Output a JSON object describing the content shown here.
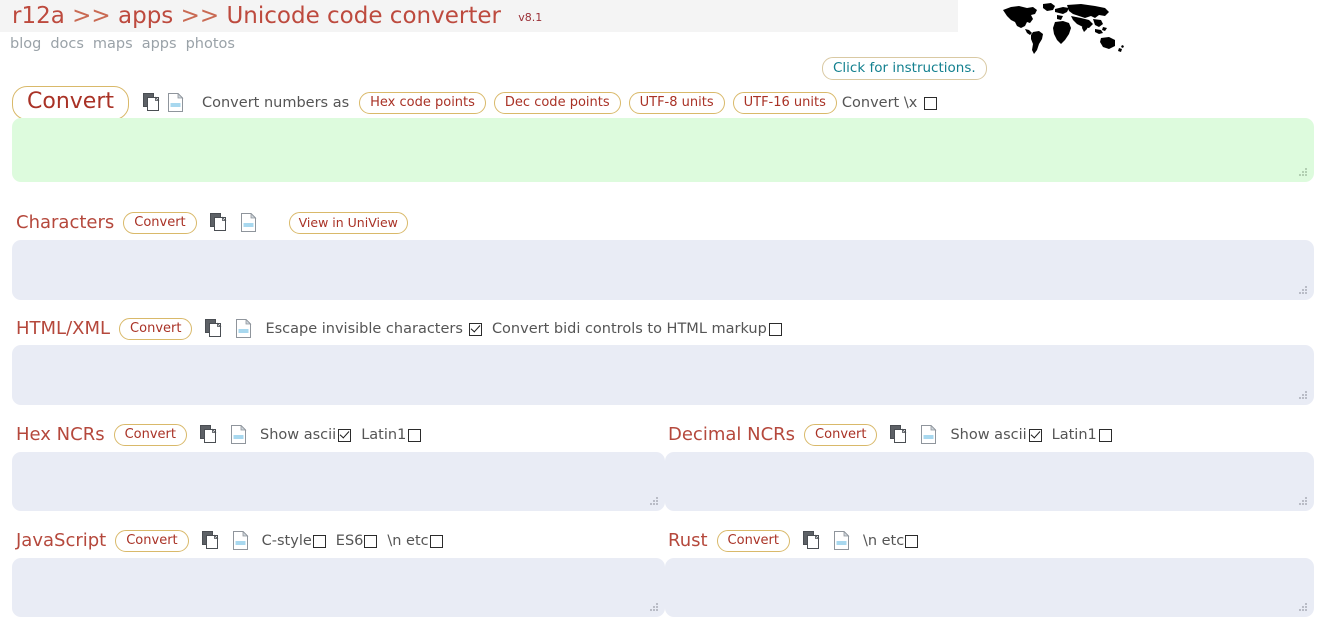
{
  "header": {
    "title_prefix": "r12a",
    "sep": ">>",
    "title_mid": "apps",
    "title_main": "Unicode code converter",
    "version": "v8.1",
    "nav": [
      {
        "label": "blog"
      },
      {
        "label": "docs"
      },
      {
        "label": "maps"
      },
      {
        "label": "apps"
      },
      {
        "label": "photos"
      }
    ],
    "instructions_button": "Click for instructions.",
    "worldmap_icon": "world-map-icon"
  },
  "colors": {
    "title_red": "#bd4a3e",
    "section_red": "#b5483c",
    "pill_border": "#d9b96a",
    "pill_text": "#a93226",
    "nav_gray": "#9aa2a8",
    "instructions_teal": "#13808f",
    "textarea_blue": "#e9ecf5",
    "textarea_green": "#ddfbdd",
    "header_band": "#f4f4f4"
  },
  "sections": {
    "input": {
      "convert_button": "Convert",
      "copy_icon": "copy-icon",
      "clear_icon": "clear-page-icon",
      "convert_numbers_as_label": "Convert numbers as",
      "format_options": [
        {
          "label": "Hex code points",
          "selected": true
        },
        {
          "label": "Dec code points",
          "selected": false
        },
        {
          "label": "UTF-8 units",
          "selected": false
        },
        {
          "label": "UTF-16 units",
          "selected": false
        }
      ],
      "convert_x_label": "Convert \\x",
      "convert_x_checked": false,
      "textarea_value": "",
      "textarea_color": "green"
    },
    "characters": {
      "title": "Characters",
      "convert_button": "Convert",
      "copy_icon": "copy-icon",
      "clear_icon": "clear-page-icon",
      "uniview_button": "View in UniView",
      "textarea_value": ""
    },
    "htmlxml": {
      "title": "HTML/XML",
      "convert_button": "Convert",
      "copy_icon": "copy-icon",
      "clear_icon": "clear-page-icon",
      "escape_invisible_label": "Escape invisible characters",
      "escape_invisible_checked": true,
      "bidi_label": "Convert bidi controls to HTML markup",
      "bidi_checked": false,
      "textarea_value": ""
    },
    "hex_ncrs": {
      "title": "Hex NCRs",
      "convert_button": "Convert",
      "copy_icon": "copy-icon",
      "clear_icon": "clear-page-icon",
      "show_ascii_label": "Show ascii",
      "show_ascii_checked": true,
      "latin1_label": "Latin1",
      "latin1_checked": false,
      "textarea_value": ""
    },
    "decimal_ncrs": {
      "title": "Decimal NCRs",
      "convert_button": "Convert",
      "copy_icon": "copy-icon",
      "clear_icon": "clear-page-icon",
      "show_ascii_label": "Show ascii",
      "show_ascii_checked": true,
      "latin1_label": "Latin1",
      "latin1_checked": false,
      "textarea_value": ""
    },
    "javascript": {
      "title": "JavaScript",
      "convert_button": "Convert",
      "copy_icon": "copy-icon",
      "clear_icon": "clear-page-icon",
      "cstyle_label": "C-style",
      "cstyle_checked": false,
      "es6_label": "ES6",
      "es6_checked": false,
      "newline_label": "\\n etc",
      "newline_checked": false,
      "textarea_value": ""
    },
    "rust": {
      "title": "Rust",
      "convert_button": "Convert",
      "copy_icon": "copy-icon",
      "clear_icon": "clear-page-icon",
      "newline_label": "\\n etc",
      "newline_checked": false,
      "textarea_value": ""
    }
  }
}
